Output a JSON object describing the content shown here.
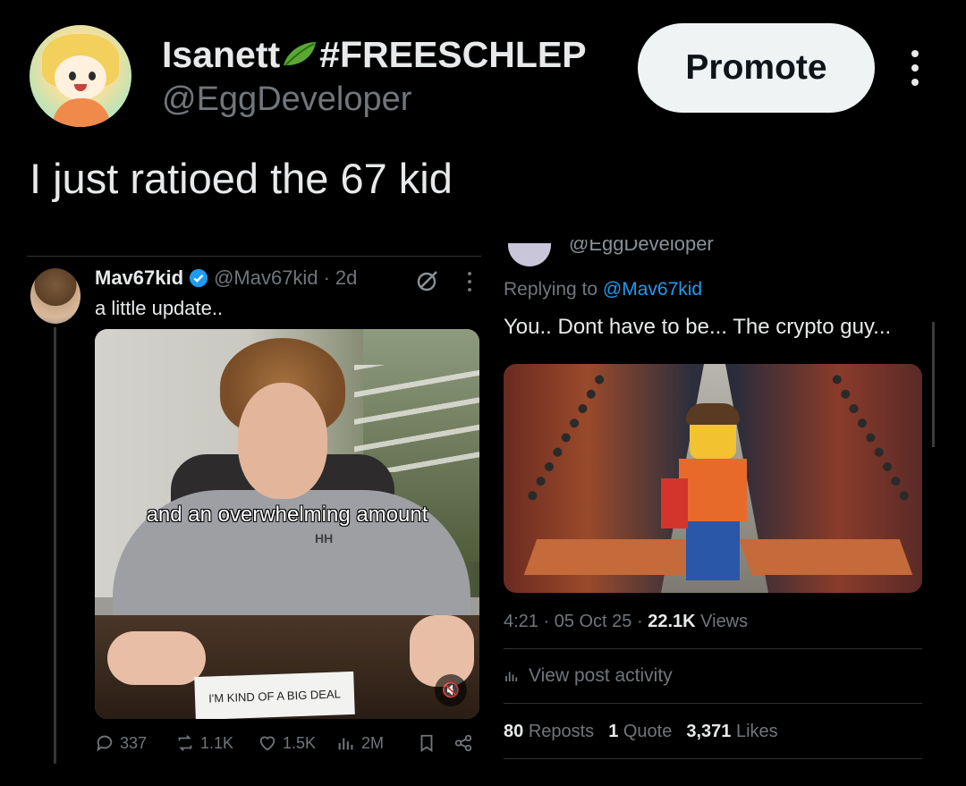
{
  "post": {
    "display_name": "Isanett",
    "name_suffix": "#FREESCHLEP",
    "handle": "@EggDeveloper",
    "promote_label": "Promote",
    "text": "I just ratioed the 67 kid"
  },
  "embedded_left": {
    "name": "Mav67kid",
    "handle": "@Mav67kid",
    "separator": "·",
    "time": "2d",
    "text": "a little update..",
    "video_caption": "and an overwhelming amount",
    "shirt_logo": "HH",
    "sign_text": "I'M KIND OF A BIG DEAL",
    "actions": {
      "replies": "337",
      "reposts": "1.1K",
      "likes": "1.5K",
      "views": "2M"
    }
  },
  "embedded_right": {
    "top_handle": "@EggDeveloper",
    "replying_prefix": "Replying to",
    "replying_to": "@Mav67kid",
    "text": "You.. Dont have to be... The crypto guy...",
    "time": "4:21 · 05 Oct 25 ·",
    "views_count": "22.1K",
    "views_label": "Views",
    "activity_label": "View post activity",
    "reposts_count": "80",
    "reposts_label": "Reposts",
    "quotes_count": "1",
    "quotes_label": "Quote",
    "likes_count": "3,371",
    "likes_label": "Likes"
  },
  "icons": {
    "leaf": "leaf-icon",
    "verified": "verified-badge-icon",
    "grok": "grok-icon",
    "more": "more-icon",
    "reply": "reply-icon",
    "repost": "repost-icon",
    "like": "heart-icon",
    "views": "views-icon",
    "bookmark": "bookmark-icon",
    "share": "share-icon",
    "mute": "mute-icon"
  },
  "colors": {
    "background": "#000000",
    "text_primary": "#e7e9ea",
    "text_secondary": "#71767b",
    "accent": "#1d9bf0",
    "verified": "#1d9bf0",
    "promote_bg": "#eff3f4"
  }
}
